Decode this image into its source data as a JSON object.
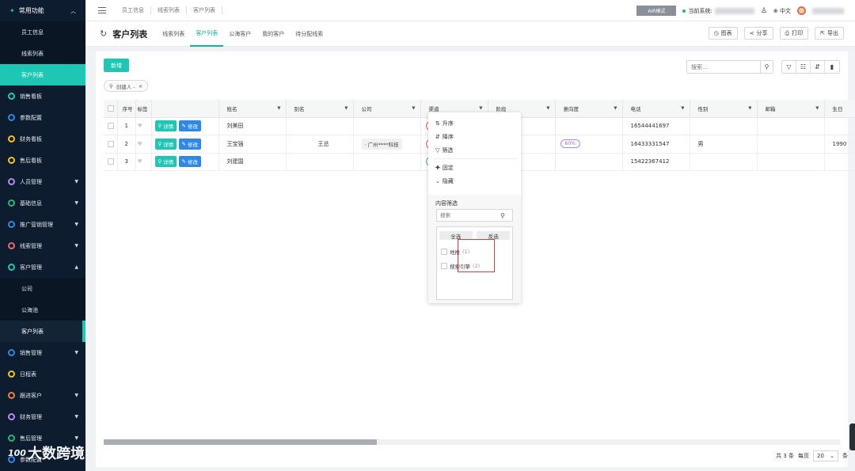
{
  "sidebar": {
    "top_label": "常用功能",
    "sub_items": [
      {
        "label": "员工信息"
      },
      {
        "label": "线索列表"
      },
      {
        "label": "客户列表"
      }
    ],
    "groups": [
      {
        "label": "销售看板",
        "color": "#1ec7b3",
        "caret": false
      },
      {
        "label": "参数配置",
        "color": "#2f88e6",
        "caret": false
      },
      {
        "label": "财务看板",
        "color": "#f5c518",
        "caret": false
      },
      {
        "label": "售后看板",
        "color": "#f5c518",
        "caret": false
      },
      {
        "label": "人员管理",
        "color": "#b68cf0",
        "caret": true
      },
      {
        "label": "基础信息",
        "color": "#2ab57d",
        "caret": true
      },
      {
        "label": "推广营销管理",
        "color": "#2f88e6",
        "caret": true
      },
      {
        "label": "线索管理",
        "color": "#e36b6b",
        "caret": true
      },
      {
        "label": "客户管理",
        "color": "#1ec7b3",
        "caret": true
      }
    ],
    "customer_sub": [
      {
        "label": "公司"
      },
      {
        "label": "公海池"
      },
      {
        "label": "客户列表"
      }
    ],
    "groups2": [
      {
        "label": "销售管理",
        "color": "#2f88e6",
        "caret": true
      },
      {
        "label": "日程表",
        "color": "#f5c518",
        "caret": false
      },
      {
        "label": "跟进客户",
        "color": "#f07e3a",
        "caret": true
      },
      {
        "label": "财务管理",
        "color": "#b68cf0",
        "caret": true
      },
      {
        "label": "售后管理",
        "color": "#2ab57d",
        "caret": true
      },
      {
        "label": "参数配置",
        "color": "#2f88e6",
        "caret": false
      }
    ],
    "logo_text": "大数跨境",
    "logo_badge": "100"
  },
  "header": {
    "breadcrumbs": [
      "员工信息",
      "线索列表",
      "客户列表"
    ],
    "air_mode": "AIR模式",
    "current_system_label": "当前系统:",
    "language": "中文"
  },
  "tabrow": {
    "title": "客户列表",
    "tabs": [
      "线索列表",
      "客户列表",
      "公海客户",
      "我的客户",
      "待分配线索"
    ],
    "active_tab": 1,
    "buttons": [
      {
        "icon": "chart-icon",
        "glyph": "◷",
        "label": "图表"
      },
      {
        "icon": "share-icon",
        "glyph": "⋖",
        "label": "分享"
      },
      {
        "icon": "print-icon",
        "glyph": "⎙",
        "label": "打印"
      },
      {
        "icon": "export-icon",
        "glyph": "⇱",
        "label": "导出"
      }
    ]
  },
  "toolbar": {
    "add_label": "新增",
    "filter_tag": "创建人 -",
    "search_placeholder": "搜索..."
  },
  "table": {
    "columns": [
      "序号",
      "标签",
      "",
      "姓名",
      "别名",
      "公司",
      "渠道",
      "阶段",
      "意向度",
      "电话",
      "性别",
      "邮箱",
      "生日"
    ],
    "detail_label": "详情",
    "edit_label": "修改",
    "rows": [
      {
        "index": "1",
        "name": "刘美田",
        "alias": "",
        "company": "",
        "channel": "red",
        "intent": "",
        "phone": "16544441697",
        "gender": "",
        "email": "",
        "birthday": ""
      },
      {
        "index": "2",
        "name": "王宝强",
        "alias": "王总",
        "company": "广州****科技",
        "channel": "red",
        "intent": "60%",
        "phone": "16433331547",
        "gender": "男",
        "email": "",
        "birthday": "1990"
      },
      {
        "index": "3",
        "name": "刘建国",
        "alias": "",
        "company": "",
        "channel": "blue",
        "intent": "",
        "phone": "15422367412",
        "gender": "",
        "email": "",
        "birthday": ""
      }
    ]
  },
  "dropdown": {
    "items": [
      {
        "icon": "sort-asc-icon",
        "glyph": "⇅",
        "label": "升序"
      },
      {
        "icon": "sort-desc-icon",
        "glyph": "⇵",
        "label": "降序"
      },
      {
        "icon": "filter-icon",
        "glyph": "▽",
        "label": "筛选"
      },
      {
        "icon": "pin-icon",
        "glyph": "✚",
        "label": "固定"
      },
      {
        "icon": "hide-icon",
        "glyph": "⌄",
        "label": "隐藏"
      }
    ],
    "content_filter_label": "内容筛选",
    "search_placeholder": "搜索",
    "select_all": "全选",
    "invert": "反选",
    "options": [
      {
        "label": "地推",
        "count": "(1)"
      },
      {
        "label": "搜索引擎",
        "count": "(2)"
      }
    ]
  },
  "pagination": {
    "total": "共 3 条",
    "per_page_label": "每页",
    "per_page": "20",
    "unit": "条"
  }
}
